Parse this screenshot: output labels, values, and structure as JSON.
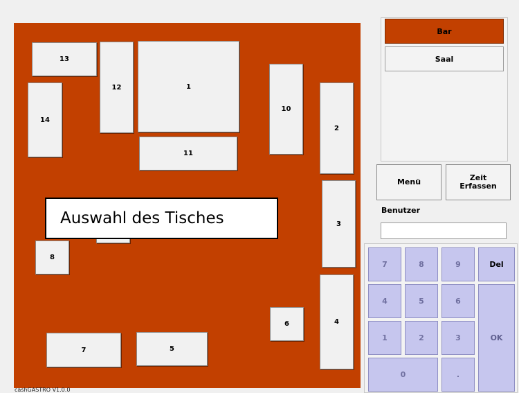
{
  "floor": {
    "tables": [
      {
        "label": "13"
      },
      {
        "label": "12"
      },
      {
        "label": "1"
      },
      {
        "label": "14"
      },
      {
        "label": "11"
      },
      {
        "label": "10"
      },
      {
        "label": "2"
      },
      {
        "label": "3"
      },
      {
        "label": "8"
      },
      {
        "label": ""
      },
      {
        "label": "6"
      },
      {
        "label": "4"
      },
      {
        "label": "7"
      },
      {
        "label": "5"
      }
    ]
  },
  "callout": "Auswahl des Tisches",
  "version": "cashGASTRO V1.0.0",
  "areas": [
    {
      "label": "Bar"
    },
    {
      "label": "Saal"
    }
  ],
  "actions": {
    "menu": "Menü",
    "time_line1": "Zeit",
    "time_line2": "Erfassen"
  },
  "user": {
    "label": "Benutzer",
    "value": ""
  },
  "keypad": {
    "k7": "7",
    "k8": "8",
    "k9": "9",
    "del": "Del",
    "k4": "4",
    "k5": "5",
    "k6": "6",
    "k1": "1",
    "k2": "2",
    "k3": "3",
    "ok": "OK",
    "k0": "0",
    "dot": "."
  },
  "colors": {
    "floor": "#c24000",
    "key": "#c6c6ee",
    "panel": "#f0f0f0"
  }
}
